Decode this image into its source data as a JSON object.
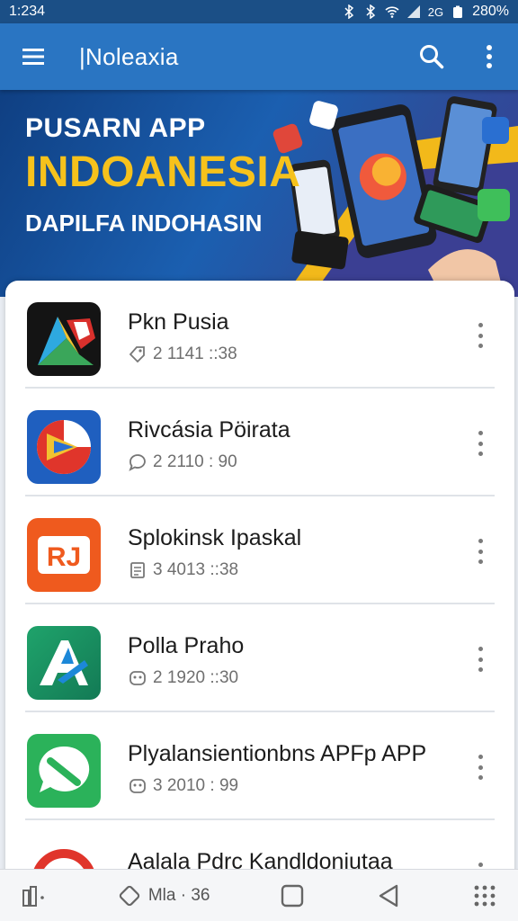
{
  "status_bar": {
    "time": "1:234",
    "battery": "280%",
    "signal_label": "2G"
  },
  "app_bar": {
    "title": "|Noleaxia",
    "menu_icon": "hamburger-icon",
    "search_icon": "search-icon",
    "more_icon": "more-vertical-icon"
  },
  "banner": {
    "line1": "PUSARN APP",
    "line2": "INDOANESIA",
    "line3": "DAPILFA INDOHASIN",
    "accent_color": "#f6c21c"
  },
  "apps": [
    {
      "name": "Pkn Pusia",
      "meta": "2 1141 ::38",
      "icon": "triangle-logo-icon",
      "meta_icon": "tag-icon"
    },
    {
      "name": "Rivcásia Pöirata",
      "meta": "2 2110 : 90",
      "icon": "play-circle-logo-icon",
      "meta_icon": "chat-icon"
    },
    {
      "name": "Splokinsk Ipaskal",
      "meta": "3 4013 ::38",
      "icon": "rj-logo-icon",
      "meta_icon": "document-icon"
    },
    {
      "name": "Polla Praho",
      "meta": "2 1920 ::30",
      "icon": "a-arrow-logo-icon",
      "meta_icon": "face-icon"
    },
    {
      "name": "Plyalansientionbns APFp APP",
      "meta": "3 2010 : 99",
      "icon": "chat-bubble-logo-icon",
      "meta_icon": "face-icon"
    },
    {
      "name": "Aalala Pdrc Kandldoniutaa",
      "meta": "",
      "icon": "red-arc-logo-icon",
      "meta_icon": ""
    }
  ],
  "bottom_nav": {
    "center_label": "Mla · 36",
    "items": [
      "apps-icon",
      "tag-icon",
      "square-icon",
      "back-icon",
      "grid-dots-icon"
    ]
  }
}
